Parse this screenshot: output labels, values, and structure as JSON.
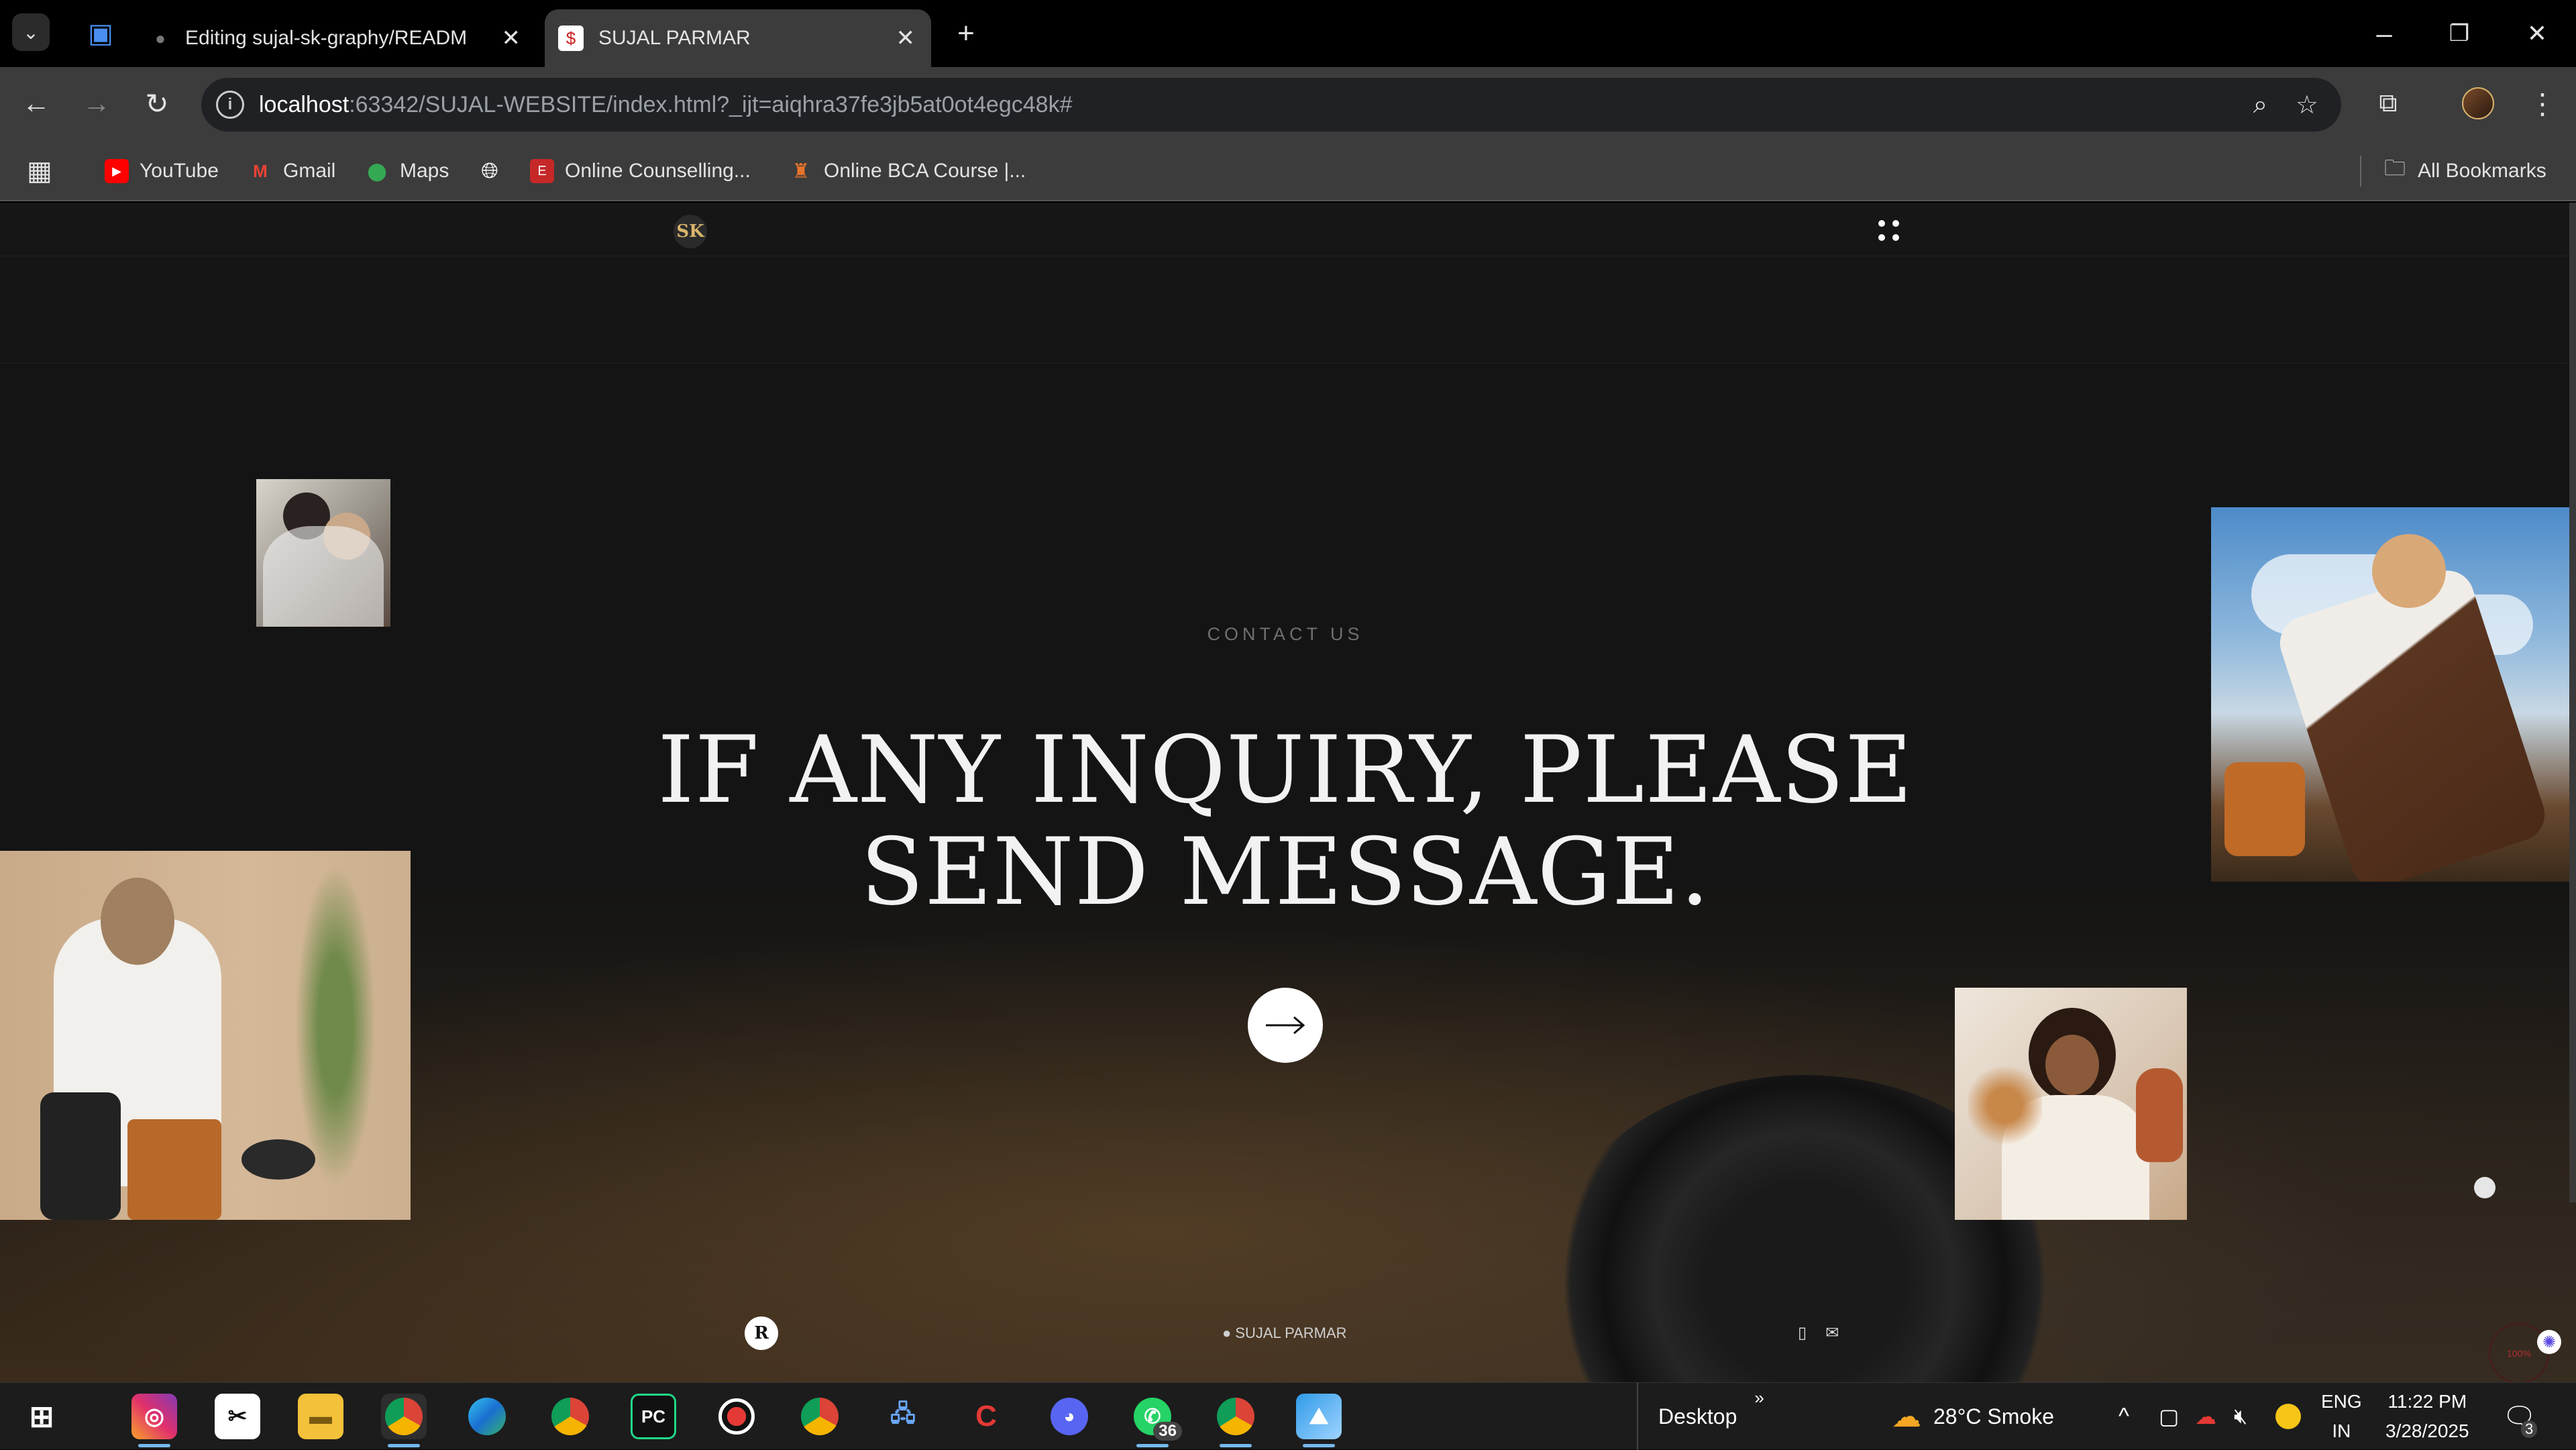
{
  "browser": {
    "tabs": [
      {
        "title": "Editing sujal-sk-graphy/READM",
        "favicon": "github-icon",
        "active": false
      },
      {
        "title": "SUJAL PARMAR",
        "favicon": "dollar-s-icon",
        "active": true
      }
    ],
    "new_tab_label": "+",
    "address": {
      "host": "localhost",
      "path": ":63342/SUJAL-WEBSITE/index.html?_ijt=aiqhra37fe3jb5at0ot4egc48k#"
    },
    "bookmarks": [
      {
        "label": "YouTube",
        "icon": "youtube-icon"
      },
      {
        "label": "Gmail",
        "icon": "gmail-icon"
      },
      {
        "label": "Maps",
        "icon": "maps-icon"
      },
      {
        "label": "",
        "icon": "globe-icon"
      },
      {
        "label": "Online Counselling...",
        "icon": "counselling-icon"
      },
      {
        "label": "Online BCA Course |...",
        "icon": "course-icon"
      }
    ],
    "all_bookmarks_label": "All Bookmarks"
  },
  "site": {
    "logo_text": "SK",
    "kicker": "CONTACT US",
    "headline_line1": "IF ANY INQUIRY, PLEASE",
    "headline_line2": "SEND MESSAGE.",
    "footer_badge": "R",
    "footer_name": "SUJAL PARMAR",
    "progress_text": "100%"
  },
  "taskbar": {
    "desktop_label": "Desktop",
    "weather": "28°C  Smoke",
    "lang_line1": "ENG",
    "lang_line2": "IN",
    "time": "11:22 PM",
    "date": "3/28/2025",
    "whatsapp_badge": "36",
    "notif_badge": "3"
  },
  "colors": {
    "accent_gold": "#d9b46c",
    "chrome_bg": "#3c3c3c",
    "page_bg": "#141414"
  }
}
